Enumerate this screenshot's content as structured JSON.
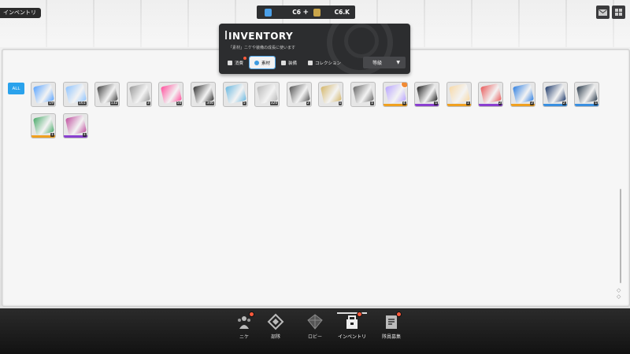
{
  "location_label": "インベントリ",
  "currencies": [
    {
      "icon": "gem-icon",
      "value": "C6",
      "has_plus": true,
      "color": "#4a9fe8"
    },
    {
      "icon": "credit-card-icon",
      "value": "C6.K",
      "has_plus": false,
      "color": "#c9a54a"
    }
  ],
  "top_right": [
    {
      "icon": "mail-icon"
    },
    {
      "icon": "menu-grid-icon"
    }
  ],
  "header": {
    "title": "INVENTORY",
    "subtitle": "「素材」ニケや装備の成長に使います",
    "tabs": [
      {
        "label": "消費",
        "icon": "consumable-icon",
        "active": false,
        "dot": true
      },
      {
        "label": "素材",
        "icon": "material-icon",
        "active": true,
        "dot": false
      },
      {
        "label": "装備",
        "icon": "equipment-icon",
        "active": false,
        "dot": false
      },
      {
        "label": "コレクション",
        "icon": "collection-icon",
        "active": false,
        "dot": false
      }
    ],
    "sort": {
      "label": "等級",
      "arrow": "▼"
    }
  },
  "filter": {
    "label": "ALL"
  },
  "items": [
    {
      "name": "blue-crystal",
      "color": "#5aa4ff",
      "count": "19",
      "rarity": null,
      "badge": false
    },
    {
      "name": "blue-battery",
      "color": "#8fc4ff",
      "count": "161",
      "rarity": null,
      "badge": false
    },
    {
      "name": "battery-module",
      "color": "#444",
      "count": "132",
      "rarity": null,
      "badge": false
    },
    {
      "name": "core-drive",
      "color": "#999",
      "count": "3",
      "rarity": null,
      "badge": false
    },
    {
      "name": "pink-heart",
      "color": "#ff4f9c",
      "count": "50",
      "rarity": null,
      "badge": false
    },
    {
      "name": "circuit-board",
      "color": "#333",
      "count": "346",
      "rarity": null,
      "badge": false
    },
    {
      "name": "data-module",
      "color": "#6ab8e0",
      "count": "5",
      "rarity": null,
      "badge": false
    },
    {
      "name": "metal-plate",
      "color": "#b8b8b8",
      "count": "320",
      "rarity": null,
      "badge": false
    },
    {
      "name": "chip-card",
      "color": "#555",
      "count": "2",
      "rarity": null,
      "badge": false
    },
    {
      "name": "gold-plate",
      "color": "#d4b66a",
      "count": "1",
      "rarity": null,
      "badge": false
    },
    {
      "name": "device-box",
      "color": "#666",
      "count": "1",
      "rarity": null,
      "badge": false
    },
    {
      "name": "holo-card",
      "color": "#b9a5ff",
      "count": "4",
      "rarity": "#f0a020",
      "badge": true
    },
    {
      "name": "black-case",
      "color": "#222",
      "count": "1",
      "rarity": "#8a3fd0",
      "badge": false
    },
    {
      "name": "gift-ticket",
      "color": "#f7d9a8",
      "count": "1",
      "rarity": "#f0a020",
      "badge": false
    },
    {
      "name": "red-ticket",
      "color": "#e85a5a",
      "count": "2",
      "rarity": "#8a3fd0",
      "badge": false
    },
    {
      "name": "blue-crystal-large",
      "color": "#2f7fe0",
      "count": "2",
      "rarity": "#f0a020",
      "badge": false
    },
    {
      "name": "tablet-blue",
      "color": "#1f3a6a",
      "count": "2",
      "rarity": "#3a8fe0",
      "badge": false
    },
    {
      "name": "tablet-dark",
      "color": "#2a3a4a",
      "count": "1",
      "rarity": "#3a8fe0",
      "badge": false
    },
    {
      "name": "green-canister",
      "color": "#4aaa6a",
      "count": "1",
      "rarity": "#f0a020",
      "badge": false
    },
    {
      "name": "purple-case",
      "color": "#c050a0",
      "count": "1",
      "rarity": "#8a3fd0",
      "badge": false
    }
  ],
  "nav": [
    {
      "label": "ニケ",
      "icon": "nikke-icon",
      "dot": true,
      "active": false
    },
    {
      "label": "部隊",
      "icon": "squad-icon",
      "dot": false,
      "active": false
    },
    {
      "label": "ロビー",
      "icon": "lobby-icon",
      "dot": false,
      "active": false
    },
    {
      "label": "インベントリ",
      "icon": "inventory-icon",
      "dot": true,
      "active": true
    },
    {
      "label": "隊員募集",
      "icon": "recruit-icon",
      "dot": true,
      "active": false
    }
  ]
}
